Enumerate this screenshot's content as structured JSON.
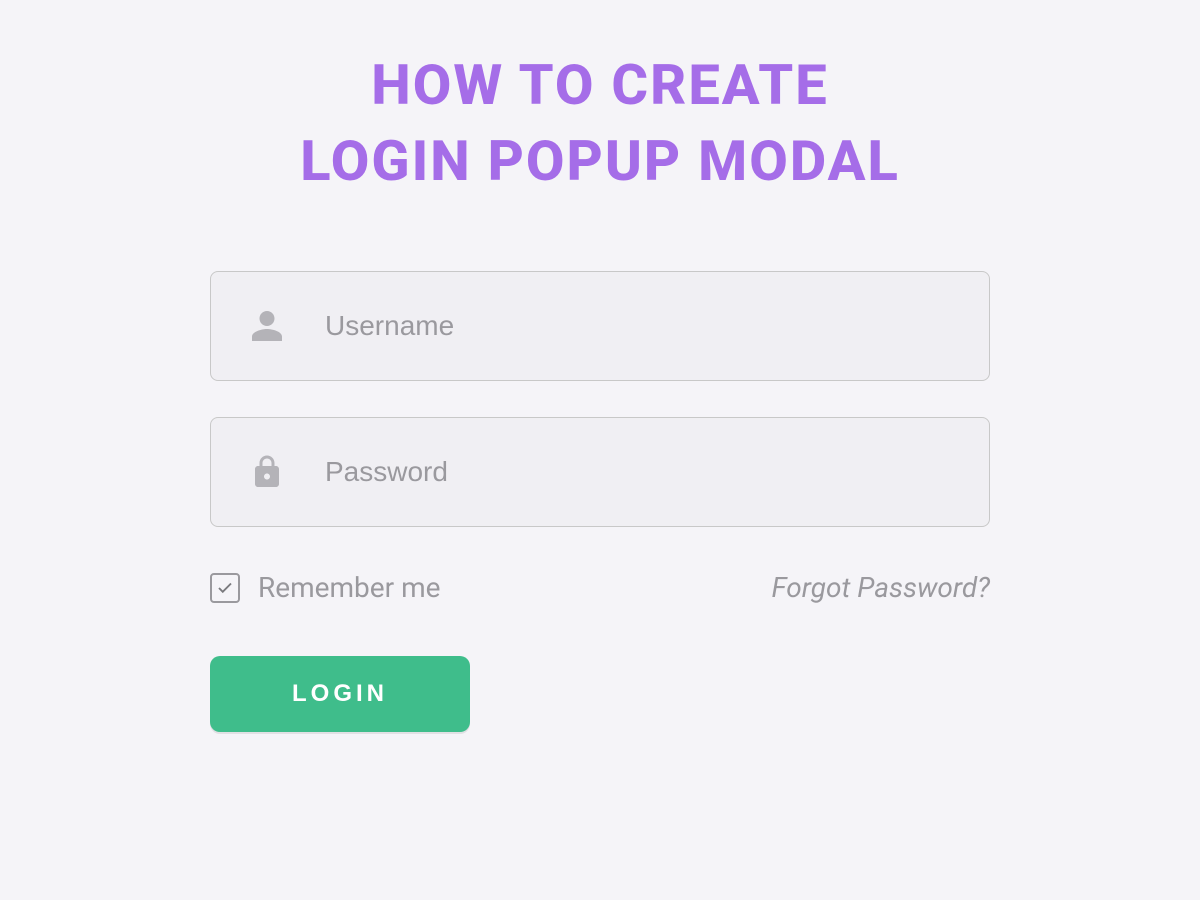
{
  "heading": {
    "line1": "HOW TO CREATE",
    "line2": "LOGIN POPUP MODAL"
  },
  "form": {
    "username": {
      "placeholder": "Username",
      "value": ""
    },
    "password": {
      "placeholder": "Password",
      "value": ""
    },
    "remember": {
      "label": "Remember me",
      "checked": true
    },
    "forgot": "Forgot Password?",
    "login_button": "LOGIN"
  },
  "colors": {
    "accent_purple": "#a56de8",
    "accent_green": "#3fbd8b",
    "bg": "#f5f4f8",
    "field_bg": "#f0eff3",
    "border": "#c8c8c8",
    "muted": "#9a999e"
  }
}
